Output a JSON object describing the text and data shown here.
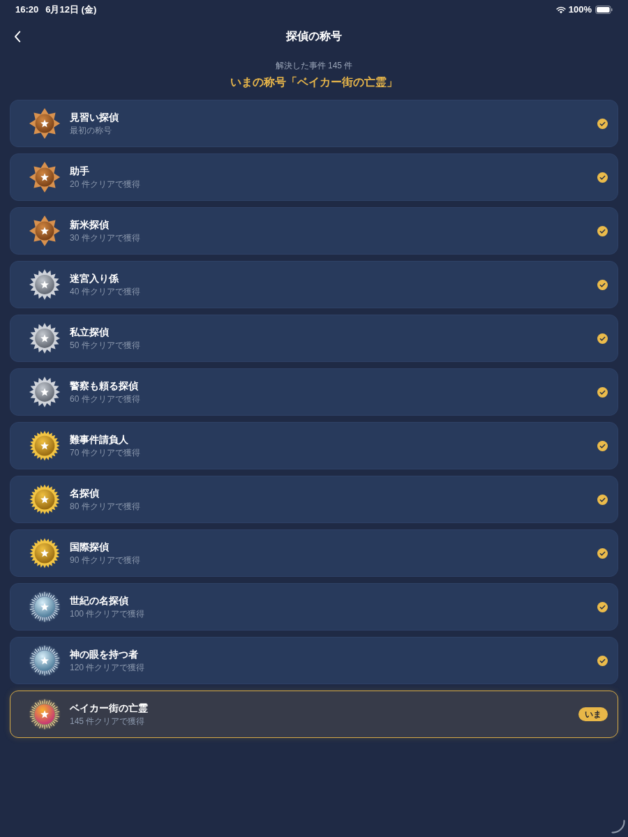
{
  "status_bar": {
    "time": "16:20",
    "date": "6月12日 (金)",
    "battery": "100%"
  },
  "header": {
    "title": "探偵の称号"
  },
  "summary": {
    "solved": "解決した事件 145 件",
    "current_title": "いまの称号「ベイカー街の亡霊」"
  },
  "titles": [
    {
      "name": "見習い探偵",
      "requirement": "最初の称号",
      "kind": "bronze",
      "checked": true,
      "selected": false
    },
    {
      "name": "助手",
      "requirement": "20 件クリアで獲得",
      "kind": "bronze",
      "checked": true,
      "selected": false
    },
    {
      "name": "新米探偵",
      "requirement": "30 件クリアで獲得",
      "kind": "bronze",
      "checked": true,
      "selected": false
    },
    {
      "name": "迷宮入り係",
      "requirement": "40 件クリアで獲得",
      "kind": "silver",
      "checked": true,
      "selected": false
    },
    {
      "name": "私立探偵",
      "requirement": "50 件クリアで獲得",
      "kind": "silver",
      "checked": true,
      "selected": false
    },
    {
      "name": "警察も頼る探偵",
      "requirement": "60 件クリアで獲得",
      "kind": "silver",
      "checked": true,
      "selected": false
    },
    {
      "name": "難事件請負人",
      "requirement": "70 件クリアで獲得",
      "kind": "gold",
      "checked": true,
      "selected": false
    },
    {
      "name": "名探偵",
      "requirement": "80 件クリアで獲得",
      "kind": "gold",
      "checked": true,
      "selected": false
    },
    {
      "name": "国際探偵",
      "requirement": "90 件クリアで獲得",
      "kind": "gold",
      "checked": true,
      "selected": false
    },
    {
      "name": "世紀の名探偵",
      "requirement": "100 件クリアで獲得",
      "kind": "platinum",
      "checked": true,
      "selected": false
    },
    {
      "name": "神の眼を持つ者",
      "requirement": "120 件クリアで獲得",
      "kind": "platinum",
      "checked": true,
      "selected": false
    },
    {
      "name": "ベイカー街の亡霊",
      "requirement": "145 件クリアで獲得",
      "kind": "legendary",
      "checked": false,
      "selected": true,
      "badge": "いま"
    }
  ]
}
